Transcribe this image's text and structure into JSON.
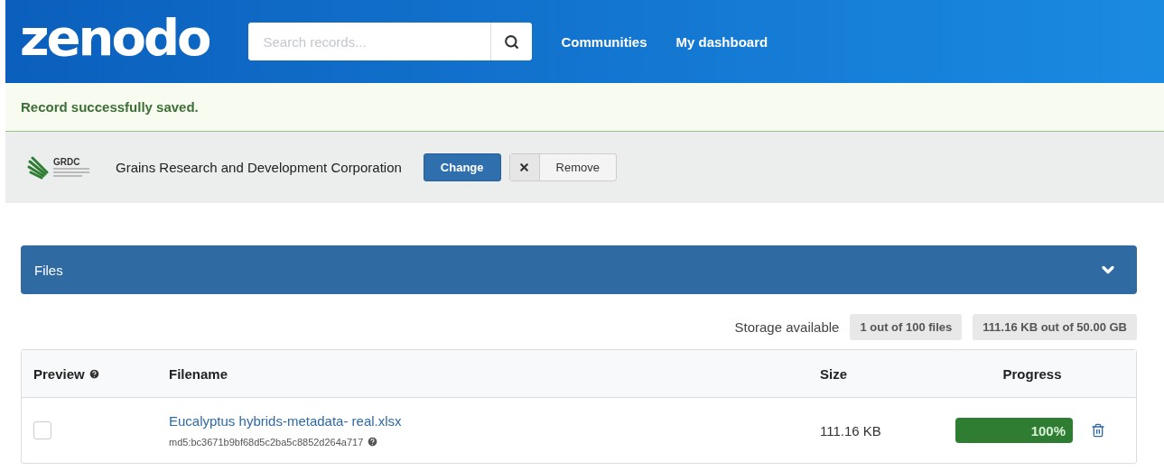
{
  "header": {
    "logo": "zenodo",
    "search": {
      "placeholder": "Search records..."
    },
    "nav": [
      "Communities",
      "My dashboard"
    ]
  },
  "alert": {
    "message": "Record successfully saved."
  },
  "community": {
    "logo_text": "GRDC",
    "name": "Grains Research and Development Corporation",
    "buttons": [
      {
        "kind": "primary",
        "label": "Change"
      },
      {
        "kind": "remove",
        "label": "Remove"
      }
    ]
  },
  "files_panel": {
    "title": "Files",
    "expanded": true
  },
  "storage": {
    "label": "Storage available",
    "badges": [
      "1 out of 100 files",
      "111.16 KB out of 50.00 GB"
    ]
  },
  "table": {
    "columns": [
      "Preview",
      "Filename",
      "Size",
      "Progress"
    ],
    "rows": [
      {
        "checked": false,
        "filename": "Eucalyptus hybrids-metadata- real.xlsx",
        "checksum": "md5:bc3671b9bf68d5c2ba5c8852d264a717",
        "size": "111.16 KB",
        "level": 1,
        "progress_text": "100%"
      }
    ]
  }
}
